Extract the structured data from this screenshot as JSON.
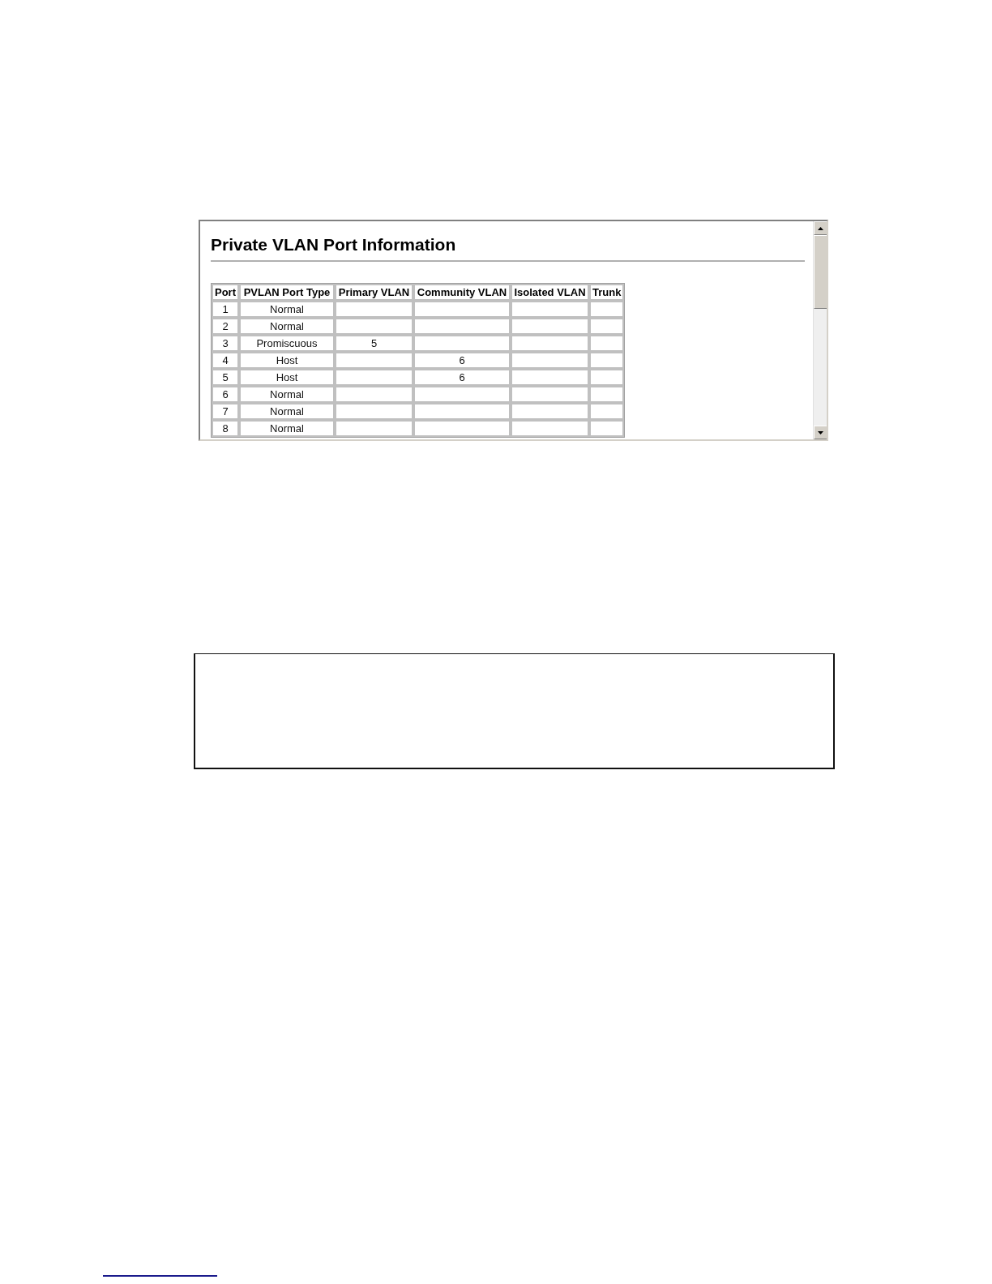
{
  "panel": {
    "title": "Private VLAN Port Information",
    "table": {
      "columns": [
        "Port",
        "PVLAN Port Type",
        "Primary VLAN",
        "Community VLAN",
        "Isolated VLAN",
        "Trunk"
      ],
      "rows": [
        [
          "1",
          "Normal",
          "",
          "",
          "",
          ""
        ],
        [
          "2",
          "Normal",
          "",
          "",
          "",
          ""
        ],
        [
          "3",
          "Promiscuous",
          "5",
          "",
          "",
          ""
        ],
        [
          "4",
          "Host",
          "",
          "6",
          "",
          ""
        ],
        [
          "5",
          "Host",
          "",
          "6",
          "",
          ""
        ],
        [
          "6",
          "Normal",
          "",
          "",
          "",
          ""
        ],
        [
          "7",
          "Normal",
          "",
          "",
          "",
          ""
        ],
        [
          "8",
          "Normal",
          "",
          "",
          "",
          ""
        ]
      ]
    }
  }
}
